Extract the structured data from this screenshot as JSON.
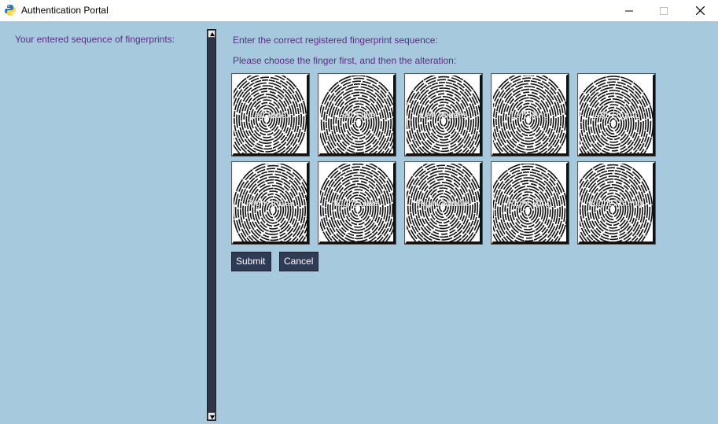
{
  "window": {
    "title": "Authentication Portal",
    "icons": {
      "app": "python-icon",
      "minimize": "minimize-icon",
      "maximize": "maximize-icon",
      "close": "close-icon"
    }
  },
  "left_panel": {
    "label": "Your entered sequence of fingerprints:"
  },
  "main": {
    "instruction_1": "Enter the correct registered fingerprint sequence:",
    "instruction_2": "Please choose the finger first, and then the alteration:",
    "fingers": [
      {
        "label": "Left Index"
      },
      {
        "label": "Left Little"
      },
      {
        "label": "Left Middle"
      },
      {
        "label": "Left Ring"
      },
      {
        "label": "Left Thumb"
      },
      {
        "label": "Right Index"
      },
      {
        "label": "Right Little"
      },
      {
        "label": "Right Middle"
      },
      {
        "label": "Right Ring"
      },
      {
        "label": "Right Thumb"
      }
    ],
    "submit_label": "Submit",
    "cancel_label": "Cancel"
  },
  "colors": {
    "background": "#a6c9de",
    "label_text": "#5d2a86",
    "button_bg": "#2f3a55",
    "scrollbar": "#2f3547"
  }
}
